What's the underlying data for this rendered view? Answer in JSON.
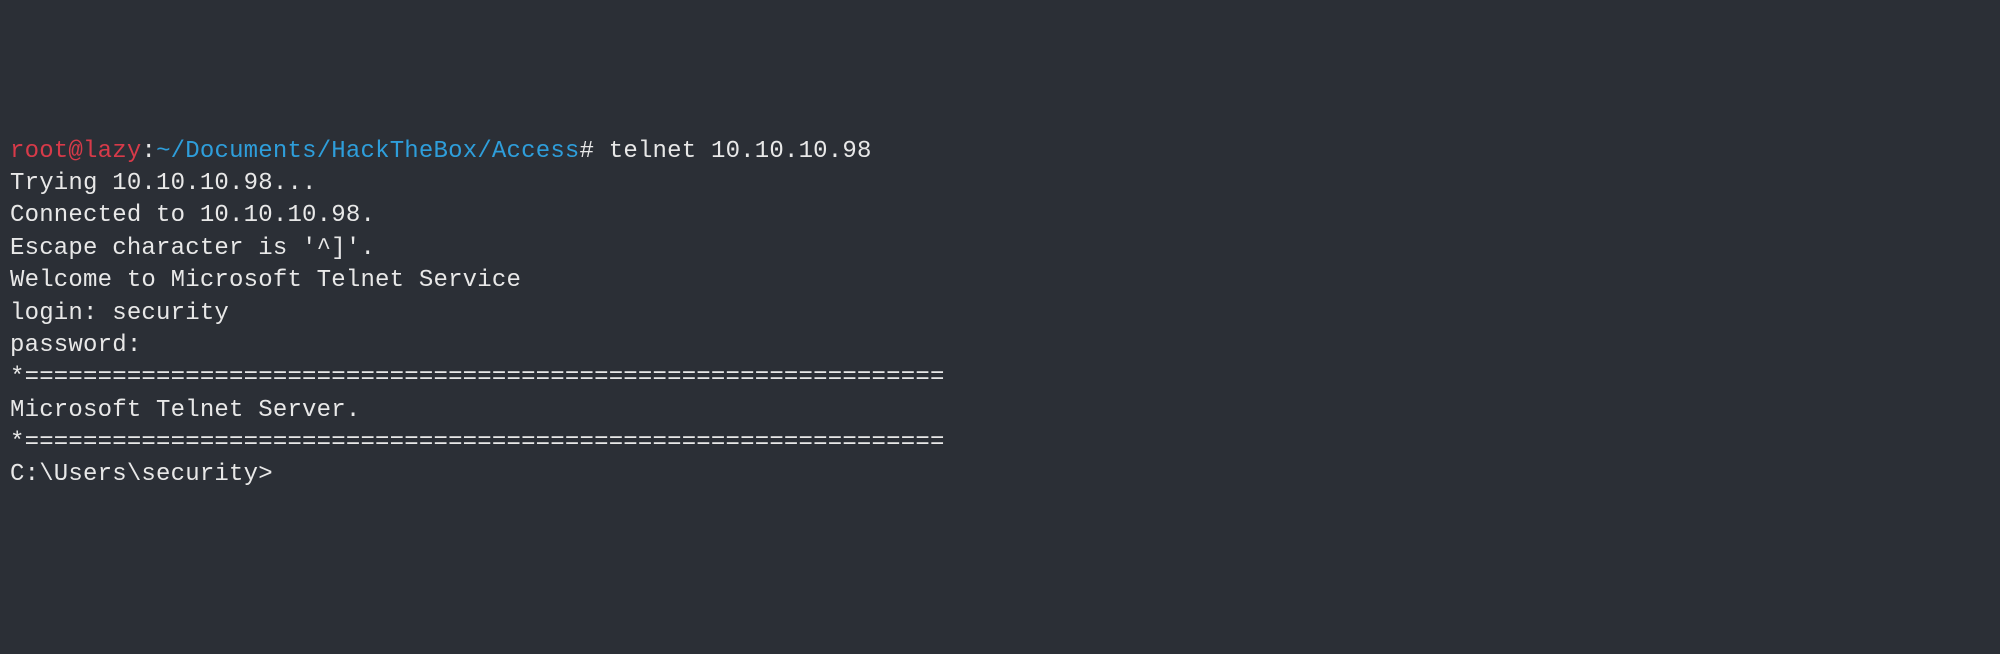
{
  "prompt": {
    "user": "root",
    "at": "@",
    "host": "lazy",
    "colon": ":",
    "path": "~/Documents/HackTheBox/Access",
    "hash": "#",
    "command": "telnet 10.10.10.98"
  },
  "output": {
    "line1": "Trying 10.10.10.98...",
    "line2": "Connected to 10.10.10.98.",
    "line3": "Escape character is '^]'.",
    "line4": "Welcome to Microsoft Telnet Service ",
    "line5": "",
    "line6": "login: security",
    "line7": "password: ",
    "line8": "",
    "line9": "*===============================================================",
    "line10": "Microsoft Telnet Server.",
    "line11": "*===============================================================",
    "line12": "C:\\Users\\security>"
  }
}
